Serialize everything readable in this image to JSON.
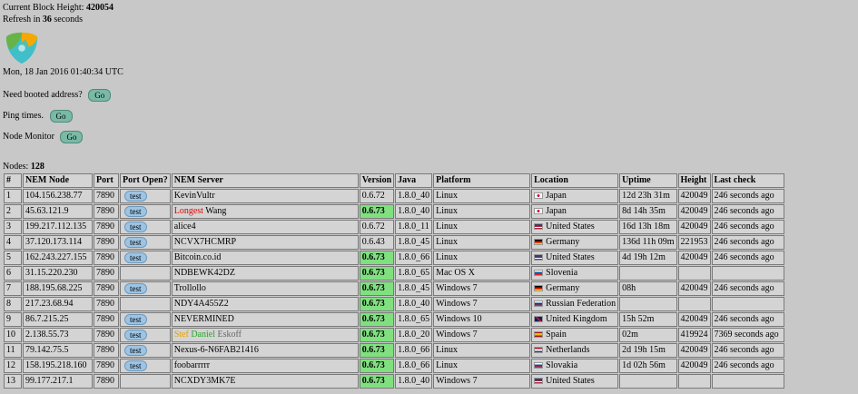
{
  "header": {
    "block_height_label": "Current Block Height: ",
    "block_height": "420054",
    "refresh_prefix": "Refresh in ",
    "refresh_seconds": "36",
    "refresh_suffix": " seconds",
    "date": "Mon, 18 Jan 2016 01:40:34 UTC"
  },
  "actions": {
    "booted_label": "Need booted address?",
    "ping_label": "Ping times.",
    "monitor_label": "Node Monitor",
    "go_label": "Go"
  },
  "nodes": {
    "label": "Nodes: ",
    "count": "128"
  },
  "table": {
    "columns": [
      "#",
      "NEM Node",
      "Port",
      "Port Open?",
      "NEM Server",
      "Version",
      "Java",
      "Platform",
      "Location",
      "Uptime",
      "Height",
      "Last check"
    ],
    "test_label": "test",
    "rows": [
      {
        "n": "1",
        "ip": "104.156.238.77",
        "port": "7890",
        "test": true,
        "server": "KevinVultr",
        "version": "0.6.72",
        "ok": false,
        "java": "1.8.0_40",
        "platform": "Linux",
        "flag": "jp",
        "location": "Japan",
        "uptime": "12d 23h 31m",
        "height": "420049",
        "last": "246 seconds ago"
      },
      {
        "n": "2",
        "ip": "45.63.121.9",
        "port": "7890",
        "test": true,
        "server_parts": [
          {
            "t": "Longest",
            "c": "red"
          },
          {
            "t": " Wang",
            "c": ""
          }
        ],
        "version": "0.6.73",
        "ok": true,
        "java": "1.8.0_40",
        "platform": "Linux",
        "flag": "jp",
        "location": "Japan",
        "uptime": "8d 14h 35m",
        "height": "420049",
        "last": "246 seconds ago"
      },
      {
        "n": "3",
        "ip": "199.217.112.135",
        "port": "7890",
        "test": true,
        "server": "alice4",
        "version": "0.6.72",
        "ok": false,
        "java": "1.8.0_11",
        "platform": "Linux",
        "flag": "us",
        "location": "United States",
        "uptime": "16d 13h 18m",
        "height": "420049",
        "last": "246 seconds ago"
      },
      {
        "n": "4",
        "ip": "37.120.173.114",
        "port": "7890",
        "test": true,
        "server": "NCVX7HCMRP",
        "version": "0.6.43",
        "ok": false,
        "java": "1.8.0_45",
        "platform": "Linux",
        "flag": "de",
        "location": "Germany",
        "uptime": "136d 11h 09m",
        "height": "221953",
        "last": "246 seconds ago"
      },
      {
        "n": "5",
        "ip": "162.243.227.155",
        "port": "7890",
        "test": true,
        "server": "Bitcoin.co.id",
        "version": "0.6.73",
        "ok": true,
        "java": "1.8.0_66",
        "platform": "Linux",
        "flag": "us",
        "location": "United States",
        "uptime": "4d 19h 12m",
        "height": "420049",
        "last": "246 seconds ago"
      },
      {
        "n": "6",
        "ip": "31.15.220.230",
        "port": "7890",
        "test": false,
        "server": "NDBEWK42DZ",
        "version": "0.6.73",
        "ok": true,
        "java": "1.8.0_65",
        "platform": "Mac OS X",
        "flag": "si",
        "location": "Slovenia",
        "uptime": "",
        "height": "",
        "last": ""
      },
      {
        "n": "7",
        "ip": "188.195.68.225",
        "port": "7890",
        "test": true,
        "server": "Trollollo",
        "version": "0.6.73",
        "ok": true,
        "java": "1.8.0_45",
        "platform": "Windows 7",
        "flag": "de",
        "location": "Germany",
        "uptime": "08h",
        "height": "420049",
        "last": "246 seconds ago"
      },
      {
        "n": "8",
        "ip": "217.23.68.94",
        "port": "7890",
        "test": false,
        "server": "NDY4A455Z2",
        "version": "0.6.73",
        "ok": true,
        "java": "1.8.0_40",
        "platform": "Windows 7",
        "flag": "ru",
        "location": "Russian Federation",
        "uptime": "",
        "height": "",
        "last": ""
      },
      {
        "n": "9",
        "ip": "86.7.215.25",
        "port": "7890",
        "test": true,
        "server": "NEVERMINED",
        "version": "0.6.73",
        "ok": true,
        "java": "1.8.0_65",
        "platform": "Windows 10",
        "flag": "gb",
        "location": "United Kingdom",
        "uptime": "15h 52m",
        "height": "420049",
        "last": "246 seconds ago"
      },
      {
        "n": "10",
        "ip": "2.138.55.73",
        "port": "7890",
        "test": true,
        "server_parts": [
          {
            "t": "Stef ",
            "c": "orange"
          },
          {
            "t": "Daniel ",
            "c": "green"
          },
          {
            "t": "Eskoff",
            "c": "gray"
          }
        ],
        "version": "0.6.73",
        "ok": true,
        "java": "1.8.0_20",
        "platform": "Windows 7",
        "flag": "es",
        "location": "Spain",
        "uptime": "02m",
        "height": "419924",
        "last": "7369 seconds ago"
      },
      {
        "n": "11",
        "ip": "79.142.75.5",
        "port": "7890",
        "test": true,
        "server": "Nexus-6-N6FAB21416",
        "version": "0.6.73",
        "ok": true,
        "java": "1.8.0_66",
        "platform": "Linux",
        "flag": "nl",
        "location": "Netherlands",
        "uptime": "2d 19h 15m",
        "height": "420049",
        "last": "246 seconds ago"
      },
      {
        "n": "12",
        "ip": "158.195.218.160",
        "port": "7890",
        "test": true,
        "server": "foobarrrrr",
        "version": "0.6.73",
        "ok": true,
        "java": "1.8.0_66",
        "platform": "Linux",
        "flag": "sk",
        "location": "Slovakia",
        "uptime": "1d 02h 56m",
        "height": "420049",
        "last": "246 seconds ago"
      },
      {
        "n": "13",
        "ip": "99.177.217.1",
        "port": "7890",
        "test": false,
        "server": "NCXDY3MK7E",
        "version": "0.6.73",
        "ok": true,
        "java": "1.8.0_40",
        "platform": "Windows 7",
        "flag": "us",
        "location": "United States",
        "uptime": "",
        "height": "",
        "last": ""
      }
    ]
  }
}
